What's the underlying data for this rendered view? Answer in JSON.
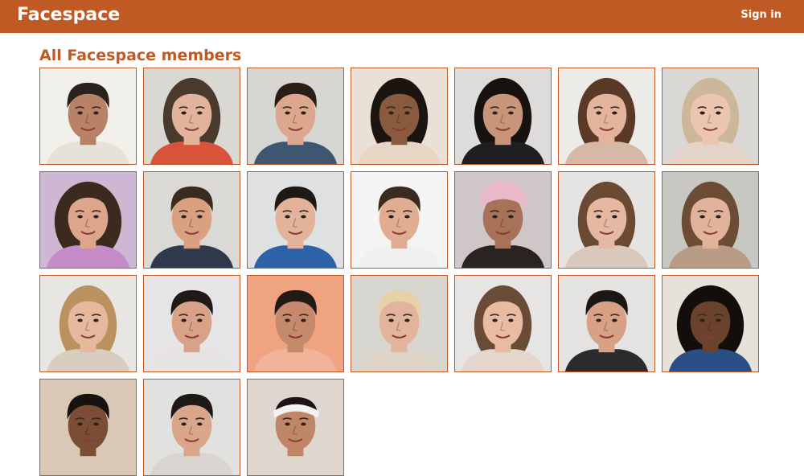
{
  "header": {
    "logo": "Facespace",
    "sign_in": "Sign in",
    "brand_color": "#c05a24"
  },
  "main": {
    "title": "All Facespace members"
  },
  "members": [
    {
      "bg": "#f1f0ea",
      "skin": "#b98266",
      "hair": "#2a221d",
      "shirt": "#e7e2d8",
      "hair_style": "short"
    },
    {
      "bg": "#d9d8d2",
      "skin": "#e2b29a",
      "hair": "#4a3a2e",
      "shirt": "#d9533a",
      "hair_style": "long"
    },
    {
      "bg": "#d8d6d3",
      "skin": "#dca78d",
      "hair": "#2b1e17",
      "shirt": "#3f5670",
      "hair_style": "short"
    },
    {
      "bg": "#e9e1d6",
      "skin": "#8a5a3e",
      "hair": "#1b1410",
      "shirt": "#e8d6c5",
      "hair_style": "long"
    },
    {
      "bg": "#dedcda",
      "skin": "#c8957a",
      "hair": "#17120f",
      "shirt": "#1f1f22",
      "hair_style": "long"
    },
    {
      "bg": "#ecebe7",
      "skin": "#e3b39c",
      "hair": "#5a3a26",
      "shirt": "#d6b8a6",
      "hair_style": "long"
    },
    {
      "bg": "#d9d8d5",
      "skin": "#ecc5b0",
      "hair": "#cdb79a",
      "shirt": "#e3d3c8",
      "hair_style": "long"
    },
    {
      "bg": "#cdb7d3",
      "skin": "#dca58c",
      "hair": "#3b2a1e",
      "shirt": "#c58ac8",
      "hair_style": "curly"
    },
    {
      "bg": "#dad9d6",
      "skin": "#d9a082",
      "hair": "#3a2a20",
      "shirt": "#2f3b4d",
      "hair_style": "short"
    },
    {
      "bg": "#dfe0e2",
      "skin": "#e2b29a",
      "hair": "#1e1915",
      "shirt": "#2e62a8",
      "hair_style": "short"
    },
    {
      "bg": "#f4f4f4",
      "skin": "#e1ad92",
      "hair": "#3a2a20",
      "shirt": "#f0f0f0",
      "hair_style": "short"
    },
    {
      "bg": "#cfc6c8",
      "skin": "#a87258",
      "hair": "#e9b9c9",
      "shirt": "#2a2321",
      "hair_style": "cap"
    },
    {
      "bg": "#e5e4e2",
      "skin": "#e5b8a1",
      "hair": "#6a4a33",
      "shirt": "#d9c8bc",
      "hair_style": "long"
    },
    {
      "bg": "#c9c7c2",
      "skin": "#e2b39b",
      "hair": "#6d4c36",
      "shirt": "#b99c86",
      "hair_style": "long"
    },
    {
      "bg": "#e8e6e2",
      "skin": "#e6b99e",
      "hair": "#b9925f",
      "shirt": "#d9cdbf",
      "hair_style": "long"
    },
    {
      "bg": "#e6e4e6",
      "skin": "#d7a287",
      "hair": "#1f1a18",
      "shirt": "#e7e3e3",
      "hair_style": "short"
    },
    {
      "bg": "#f0a381",
      "skin": "#c58a6b",
      "hair": "#221a15",
      "shirt": "#f1b49a",
      "hair_style": "short"
    },
    {
      "bg": "#d8d6d0",
      "skin": "#e2b49b",
      "hair": "#e6d2a6",
      "shirt": "#dcd4c6",
      "hair_style": "short"
    },
    {
      "bg": "#e6e5e4",
      "skin": "#e9bba3",
      "hair": "#6a4b35",
      "shirt": "#e5d6cd",
      "hair_style": "long"
    },
    {
      "bg": "#e4e3e1",
      "skin": "#d6a184",
      "hair": "#1b1714",
      "shirt": "#2b2b2e",
      "hair_style": "short"
    },
    {
      "bg": "#e7e2d9",
      "skin": "#6b432d",
      "hair": "#130e0b",
      "shirt": "#2a4f86",
      "hair_style": "curly"
    },
    {
      "bg": "#d8c8b5",
      "skin": "#7a4d34",
      "hair": "#171210",
      "shirt": "#d8c8b5",
      "hair_style": "short"
    },
    {
      "bg": "#e1e1df",
      "skin": "#d9a68a",
      "hair": "#1e1916",
      "shirt": "#d8d4d0",
      "hair_style": "short"
    },
    {
      "bg": "#dfd6cf",
      "skin": "#c08668",
      "hair": "#f2f2f2",
      "shirt": "#dfd6cf",
      "hair_style": "headband"
    }
  ]
}
